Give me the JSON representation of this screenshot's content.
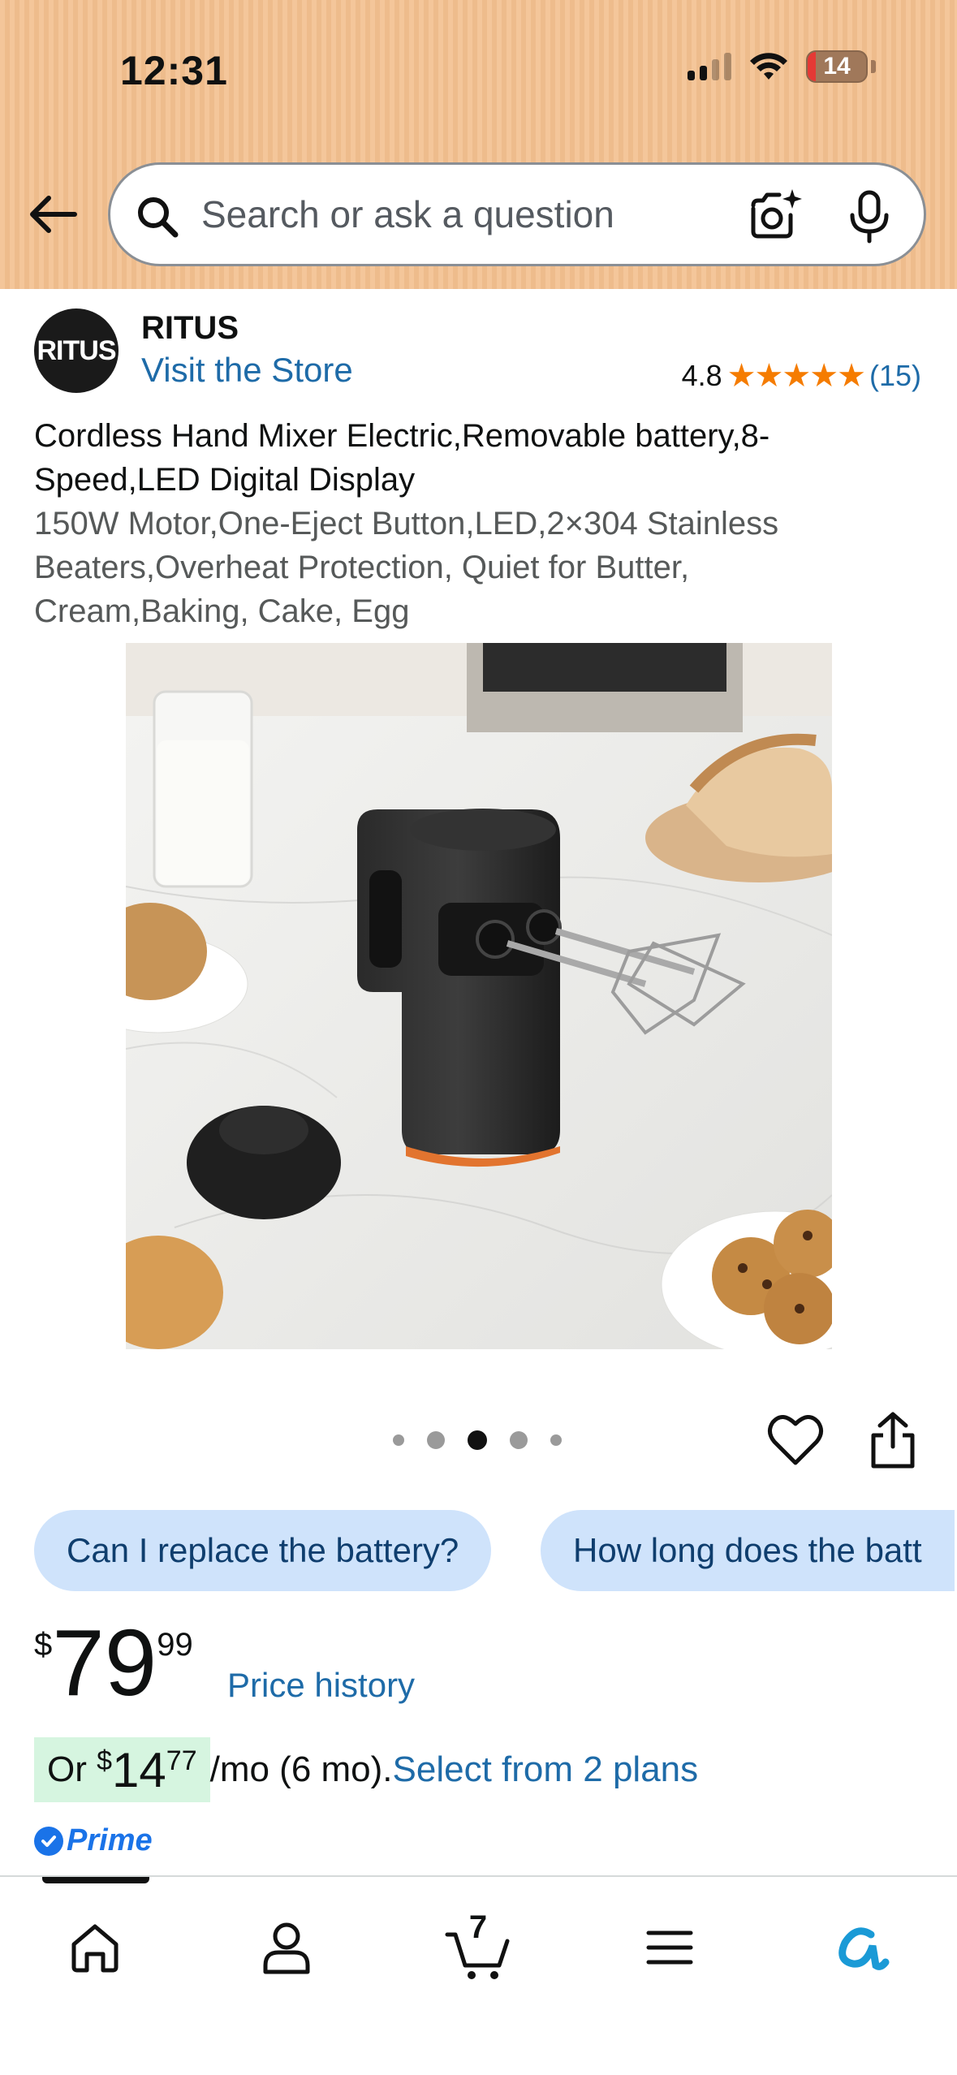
{
  "status_bar": {
    "time": "12:31",
    "battery": "14"
  },
  "search": {
    "placeholder": "Search or ask a question"
  },
  "brand": {
    "logo_text": "RITUS",
    "name": "RITUS",
    "store_link": "Visit the Store"
  },
  "rating": {
    "value": "4.8",
    "stars": "★★★★★",
    "count": "(15)"
  },
  "product": {
    "title": "Cordless Hand Mixer Electric,Removable battery,8-Speed,LED Digital Display",
    "subtitle": "150W Motor,One-Eject Button,LED,2×304 Stainless Beaters,Overheat Protection, Quiet for Butter, Cream,Baking, Cake, Egg"
  },
  "carousel": {
    "count": 5,
    "active_index": 2
  },
  "questions": [
    {
      "label": "Can I replace the battery?"
    },
    {
      "label": "How long does the batt"
    }
  ],
  "price": {
    "symbol": "$",
    "whole": "79",
    "fraction": "99",
    "history_link": "Price history"
  },
  "monthly": {
    "prefix": "Or ",
    "symbol": "$",
    "whole": "14",
    "fraction": "77",
    "rest": "/mo (6 mo).",
    "link": "Select from 2 plans"
  },
  "prime": {
    "label": "Prime"
  },
  "nav": {
    "cart_count": "7",
    "items": [
      "home",
      "account",
      "cart",
      "menu",
      "rufus"
    ]
  },
  "colors": {
    "header_bg": "#f3c08f",
    "link": "#1e6ba8",
    "star": "#f57c00",
    "chip_bg": "#cfe3fb",
    "monthly_highlight": "#d6f5e0",
    "prime": "#1a73e8"
  }
}
